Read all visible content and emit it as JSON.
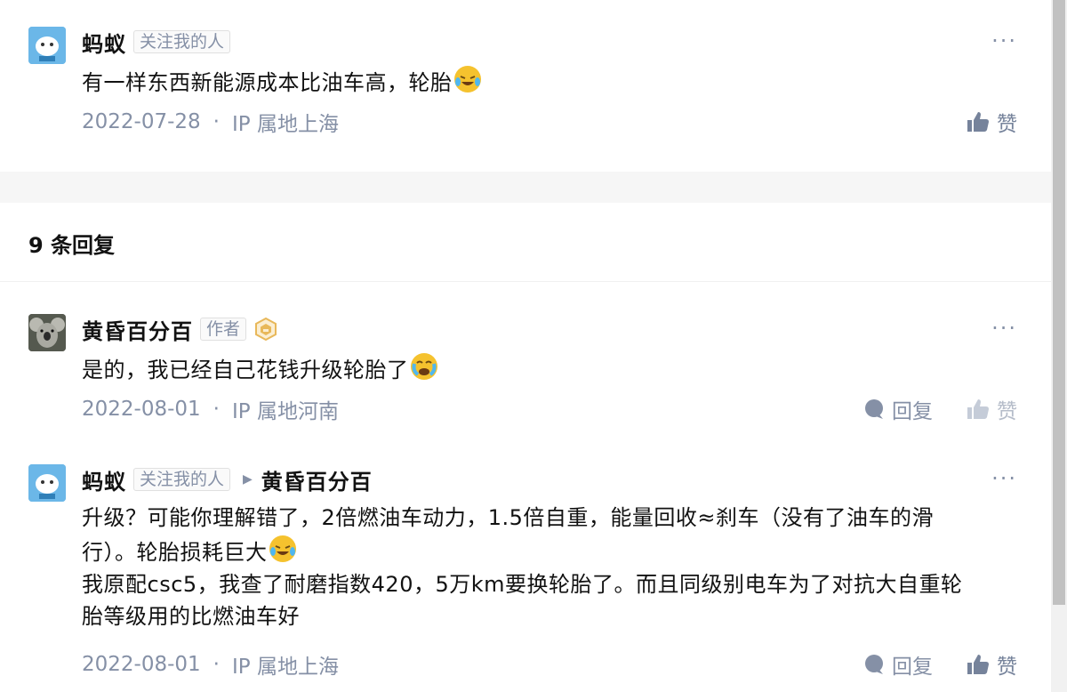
{
  "top_comment": {
    "author": "蚂蚁",
    "tag": "关注我的人",
    "text": "有一样东西新能源成本比油车高，轮胎",
    "emoji": "rofl-emoji",
    "date": "2022-07-28",
    "separator": "·",
    "location": "IP 属地上海",
    "like_label": "赞",
    "more_label": "···"
  },
  "replies_header": "9 条回复",
  "replies": [
    {
      "author": "黄昏百分百",
      "tag": "作者",
      "text": "是的，我已经自己花钱升级轮胎了",
      "emoji": "tears-emoji",
      "date": "2022-08-01",
      "separator": "·",
      "location": "IP 属地河南",
      "reply_label": "回复",
      "like_label": "赞",
      "more_label": "···"
    },
    {
      "author": "蚂蚁",
      "tag": "关注我的人",
      "reply_to": "黄昏百分百",
      "text_line1": "升级？可能你理解错了，2倍燃油车动力，1.5倍自重，能量回收≈刹车（没有了油车的滑",
      "text_line2": "行）。轮胎损耗巨大",
      "text_line3": "我原配csc5，我查了耐磨指数420，5万km要换轮胎了。而且同级别电车为了对抗大自重轮",
      "text_line4": "胎等级用的比燃油车好",
      "emoji": "rofl-emoji",
      "date": "2022-08-01",
      "separator": "·",
      "location": "IP 属地上海",
      "reply_label": "回复",
      "like_label": "赞",
      "more_label": "···"
    }
  ],
  "colors": {
    "text": "#121212",
    "meta": "#8590a6",
    "gap_band": "#f6f6f6",
    "author_badge": "#e8b85a"
  }
}
